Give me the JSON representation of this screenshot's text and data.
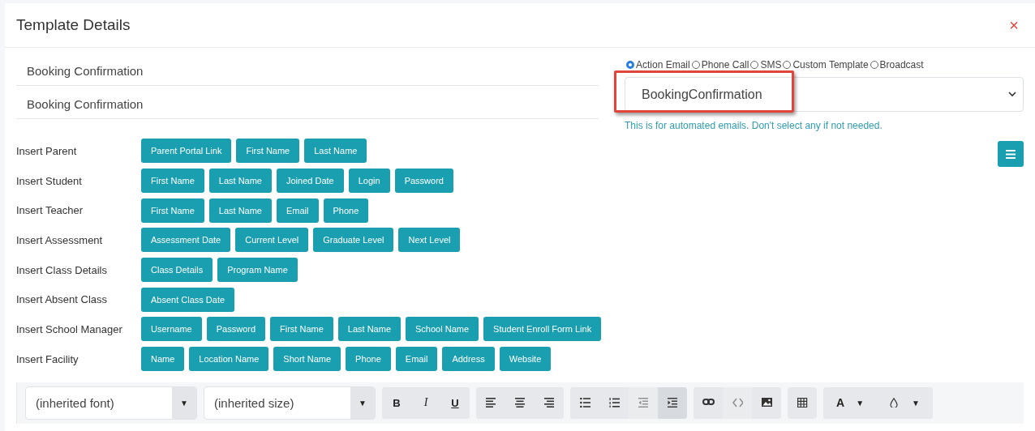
{
  "dialog": {
    "title": "Template Details",
    "close": "×"
  },
  "fields": [
    {
      "value": "Booking Confirmation"
    },
    {
      "value": "Booking Confirmation"
    }
  ],
  "template_types": [
    {
      "label": "Action Email",
      "selected": true
    },
    {
      "label": "Phone Call",
      "selected": false
    },
    {
      "label": "SMS",
      "selected": false
    },
    {
      "label": "Custom Template",
      "selected": false
    },
    {
      "label": "Broadcast",
      "selected": false
    }
  ],
  "template_select": {
    "value": "BookingConfirmation",
    "highlighted": true
  },
  "hint": "This is for automated emails. Don't select any if not needed.",
  "insert_groups": [
    {
      "label": "Insert Parent",
      "buttons": [
        "Parent Portal Link",
        "First Name",
        "Last Name"
      ]
    },
    {
      "label": "Insert Student",
      "buttons": [
        "First Name",
        "Last Name",
        "Joined Date",
        "Login",
        "Password"
      ]
    },
    {
      "label": "Insert Teacher",
      "buttons": [
        "First Name",
        "Last Name",
        "Email",
        "Phone"
      ]
    },
    {
      "label": "Insert Assessment",
      "buttons": [
        "Assessment Date",
        "Current Level",
        "Graduate Level",
        "Next Level"
      ]
    },
    {
      "label": "Insert Class Details",
      "buttons": [
        "Class Details",
        "Program Name"
      ]
    },
    {
      "label": "Insert Absent Class",
      "buttons": [
        "Absent Class Date"
      ]
    },
    {
      "label": "Insert School Manager",
      "buttons": [
        "Username",
        "Password",
        "First Name",
        "Last Name",
        "School Name",
        "Student Enroll Form Link"
      ]
    },
    {
      "label": "Insert Facility",
      "buttons": [
        "Name",
        "Location Name",
        "Short Name",
        "Phone",
        "Email",
        "Address",
        "Website"
      ]
    }
  ],
  "toolbar": {
    "selects": [
      {
        "value": "(inherited font)",
        "caret": "▼"
      },
      {
        "value": "(inherited size)",
        "caret": "▼"
      }
    ],
    "groups": [
      [
        {
          "kind": "bold",
          "label": "B",
          "active": false,
          "disabled": false
        },
        {
          "kind": "italic",
          "label": "I",
          "active": false,
          "disabled": false
        },
        {
          "kind": "underline",
          "label": "U",
          "active": false,
          "disabled": false
        }
      ],
      [
        {
          "kind": "align-left",
          "active": false,
          "disabled": false
        },
        {
          "kind": "align-center",
          "active": false,
          "disabled": false
        },
        {
          "kind": "align-right",
          "active": false,
          "disabled": false
        }
      ],
      [
        {
          "kind": "bullet-list",
          "active": false,
          "disabled": false
        },
        {
          "kind": "numbered-list",
          "active": false,
          "disabled": false
        },
        {
          "kind": "outdent",
          "active": false,
          "disabled": true
        },
        {
          "kind": "indent",
          "active": true,
          "disabled": false
        }
      ],
      [
        {
          "kind": "link",
          "active": false,
          "disabled": false
        },
        {
          "kind": "code",
          "active": false,
          "disabled": true
        },
        {
          "kind": "image",
          "active": false,
          "disabled": false
        }
      ],
      [
        {
          "kind": "table",
          "active": false,
          "disabled": false
        }
      ],
      [
        {
          "kind": "font-color",
          "label": "A",
          "caret": "▼",
          "active": false,
          "disabled": false
        },
        {
          "kind": "fill-color",
          "caret": "▼",
          "active": false,
          "disabled": false
        }
      ]
    ]
  }
}
